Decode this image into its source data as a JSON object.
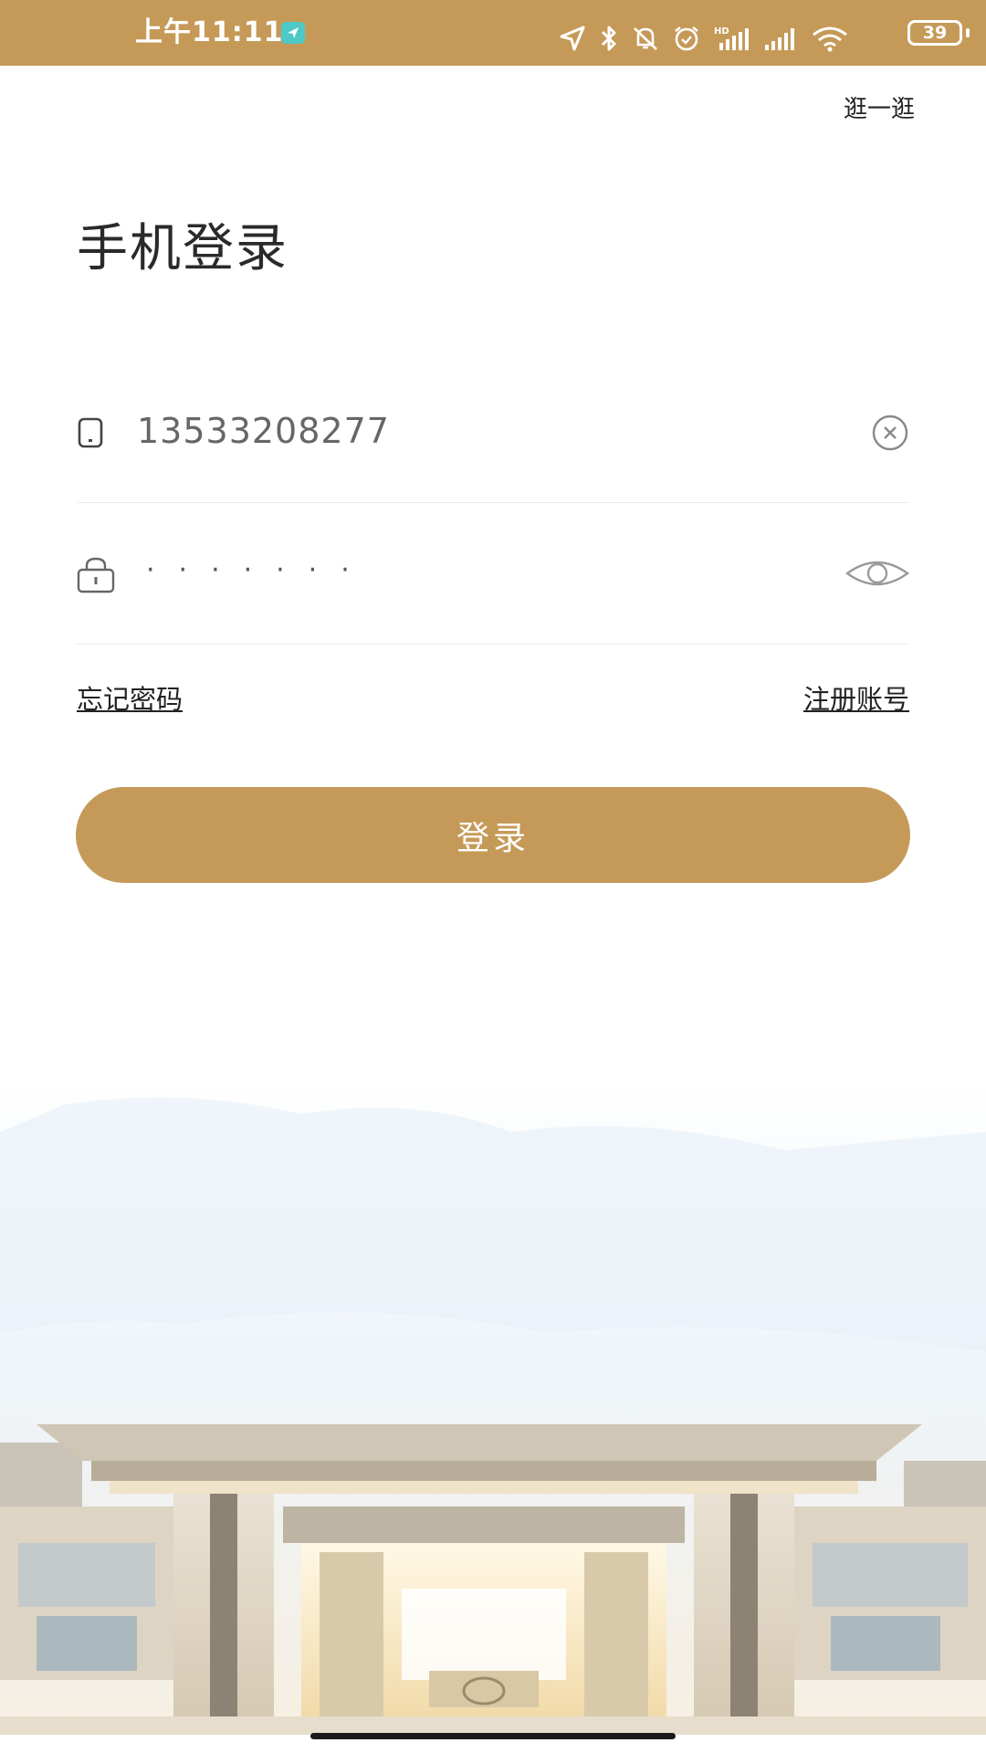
{
  "status_bar": {
    "time": "上午11:11",
    "battery": "39",
    "accent_color": "#c59a58",
    "icons": [
      "location-arrow-icon",
      "bluetooth-icon",
      "mute-bell-icon",
      "alarm-icon",
      "hd-signal-icon",
      "signal-icon",
      "wifi-icon",
      "battery-icon"
    ]
  },
  "header": {
    "skip_label": "逛一逛"
  },
  "login": {
    "title": "手机登录",
    "phone_value": "13533208277",
    "password_mask": "·······",
    "forgot_label": "忘记密码",
    "register_label": "注册账号",
    "submit_label": "登录"
  },
  "icons": {
    "phone_field": "phone-icon",
    "password_field": "lock-icon",
    "clear": "clear-circle-x-icon",
    "toggle_password": "eye-icon"
  },
  "colors": {
    "brand": "#c59a58",
    "text_primary": "#2a2a2a",
    "text_secondary": "#666666",
    "divider": "#ececec"
  }
}
